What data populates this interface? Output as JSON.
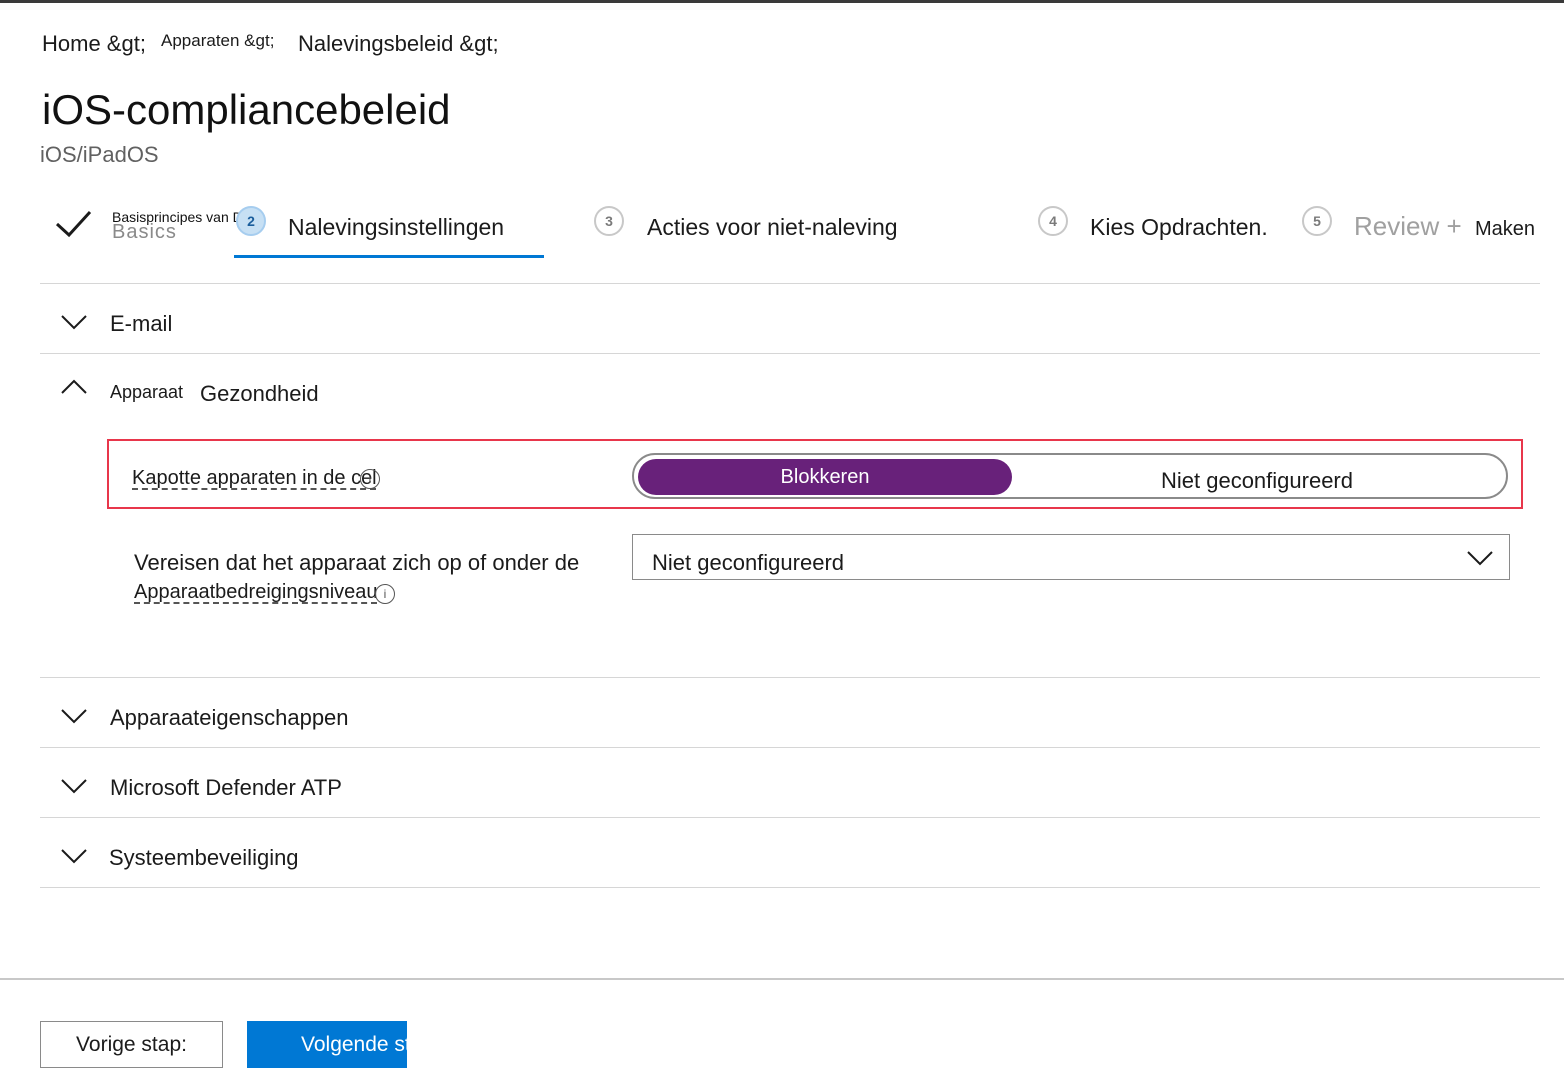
{
  "breadcrumb": {
    "home": "Home &gt;",
    "devices": "Apparaten &gt;",
    "compliance": "Nalevingsbeleid &gt;"
  },
  "page": {
    "title": "iOS-compliancebeleid",
    "subtitle": "iOS/iPadOS"
  },
  "wizard": {
    "step1_label": "Basisprincipes van DNS",
    "step1_ghost": "Basics",
    "steps": [
      {
        "number": "2",
        "label": "Nalevingsinstellingen"
      },
      {
        "number": "3",
        "label": "Acties voor niet-naleving"
      },
      {
        "number": "4",
        "label": "Kies Opdrachten."
      },
      {
        "number": "5",
        "label": "Review +",
        "label_suffix": "Maken"
      }
    ]
  },
  "sections": {
    "email": "E-mail",
    "device_health_small": "Apparaat",
    "device_health": "Gezondheid",
    "device_properties": "Apparaateigenschappen",
    "defender": "Microsoft Defender ATP",
    "system_security": "Systeembeveiliging"
  },
  "settings": {
    "jailbroken_label": "Kapotte apparaten in de cel",
    "jailbroken_on": "Blokkeren",
    "jailbroken_off": "Niet geconfigureerd",
    "threat_label_line1": "Vereisen dat het apparaat zich op of onder de",
    "threat_label_line2": "Apparaatbedreigingsniveau",
    "threat_value": "Niet geconfigureerd",
    "info_glyph": "i"
  },
  "footer": {
    "previous": "Vorige stap:",
    "next": "Volgende stap"
  },
  "colors": {
    "accent": "#0078d4",
    "toggle_on": "#68217a",
    "highlight": "#e8364b"
  }
}
